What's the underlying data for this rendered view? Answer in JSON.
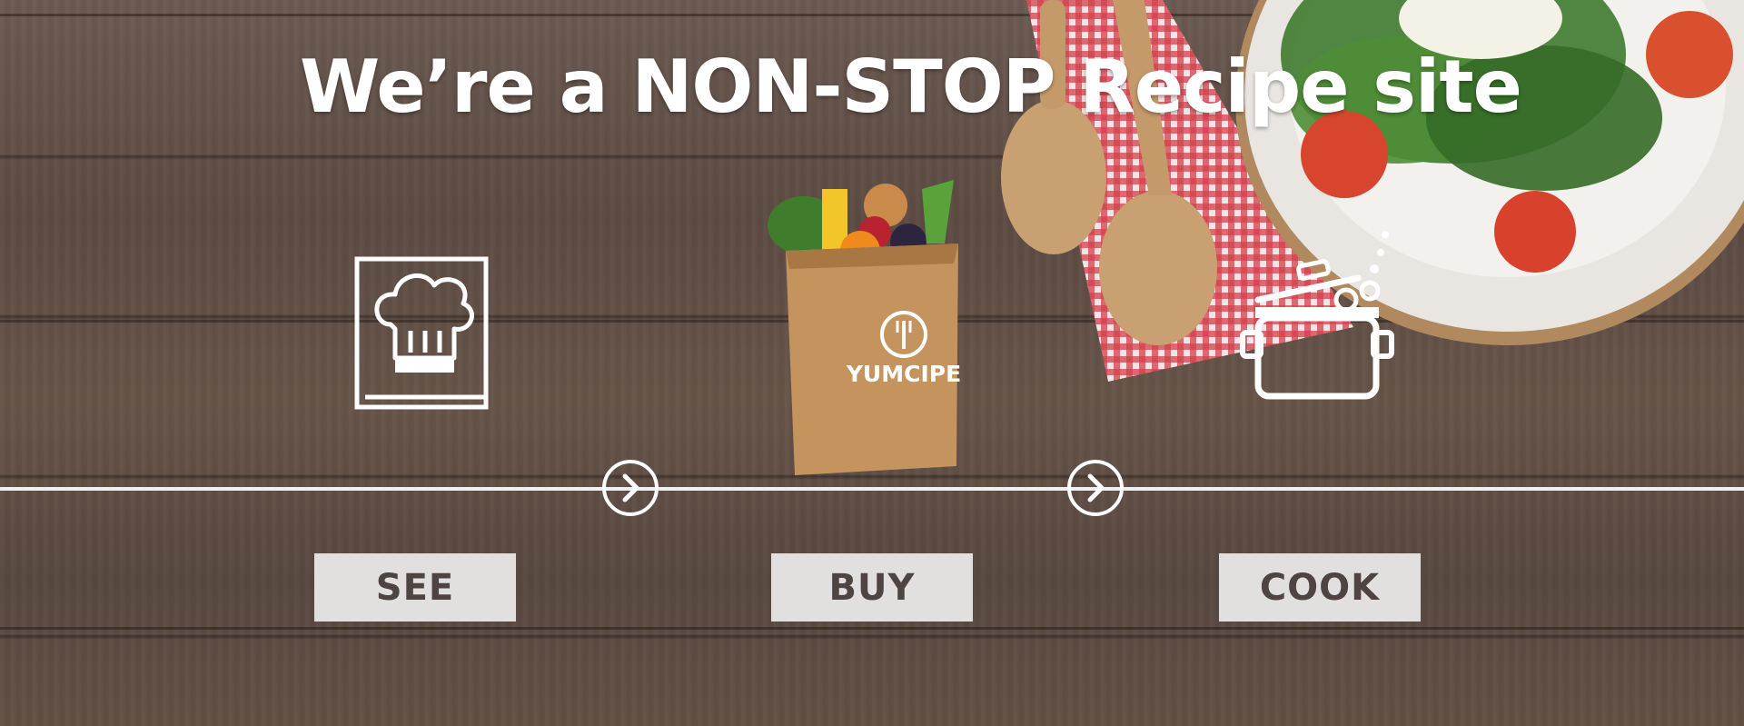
{
  "hero": {
    "title": "We’re a NON-STOP Recipe site",
    "steps": [
      {
        "label": "SEE",
        "icon": "chef-hat-book-icon"
      },
      {
        "label": "BUY",
        "icon": "grocery-bag-icon"
      },
      {
        "label": "COOK",
        "icon": "cooking-pot-icon"
      }
    ],
    "bag_brand": "YUMCIPE",
    "next_icons": [
      "chevron-right-icon",
      "chevron-right-icon"
    ]
  },
  "colors": {
    "wood": "#5c4b43",
    "text": "#ffffff",
    "button_bg": "#e2e0df",
    "button_text": "#4e4442",
    "bag": "#c4935e"
  }
}
